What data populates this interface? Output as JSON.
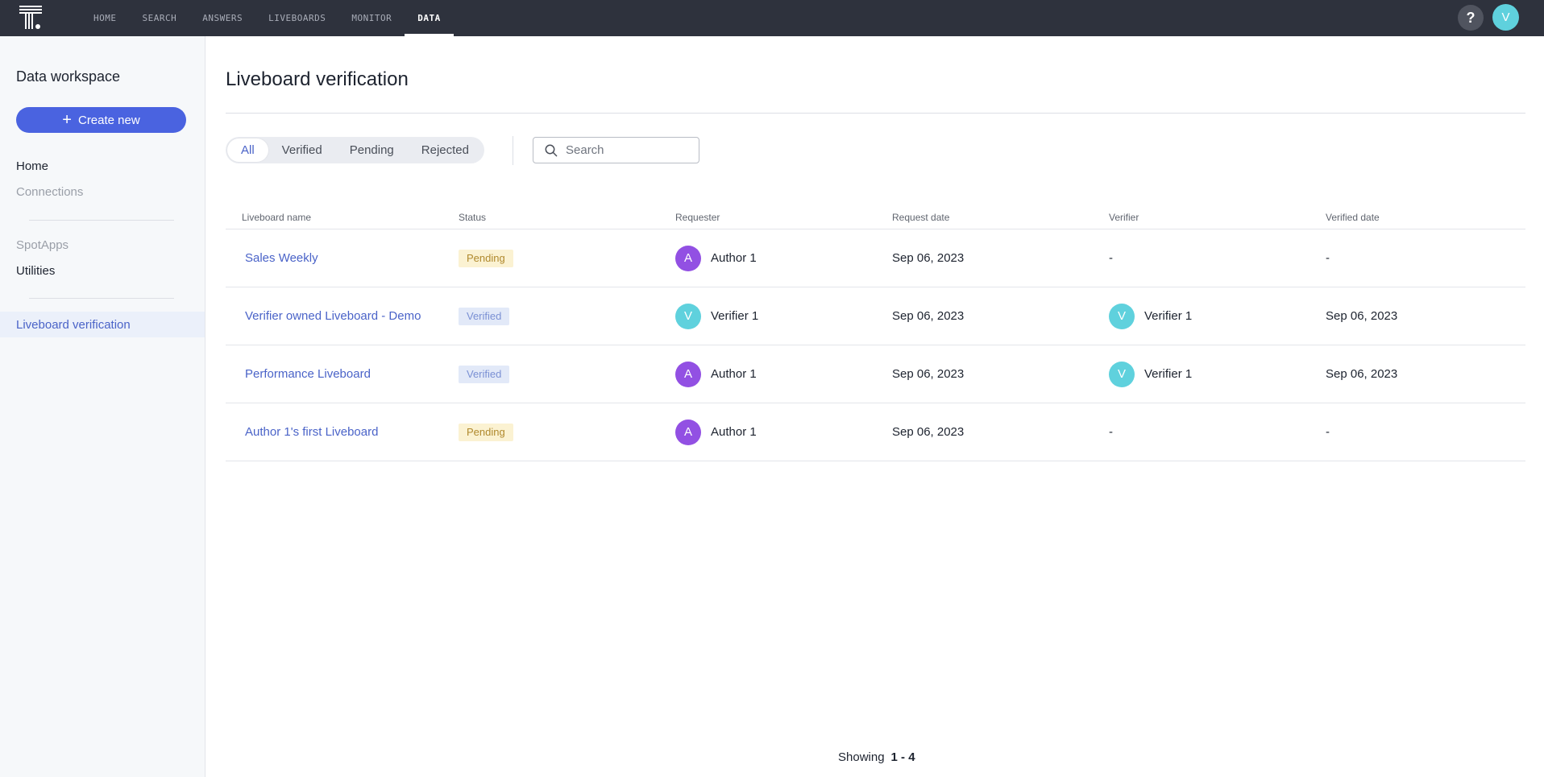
{
  "topnav": {
    "items": [
      {
        "label": "HOME",
        "active": false
      },
      {
        "label": "SEARCH",
        "active": false
      },
      {
        "label": "ANSWERS",
        "active": false
      },
      {
        "label": "LIVEBOARDS",
        "active": false
      },
      {
        "label": "MONITOR",
        "active": false
      },
      {
        "label": "DATA",
        "active": true
      }
    ],
    "help_label": "?",
    "user_initial": "V"
  },
  "sidebar": {
    "title": "Data workspace",
    "create_label": "Create new",
    "items": [
      {
        "label": "Home",
        "muted": false
      },
      {
        "label": "Connections",
        "muted": true
      },
      {
        "label": "SpotApps",
        "muted": true
      },
      {
        "label": "Utilities",
        "muted": false
      }
    ],
    "active_item": "Liveboard verification"
  },
  "main": {
    "title": "Liveboard verification",
    "filters": [
      "All",
      "Verified",
      "Pending",
      "Rejected"
    ],
    "active_filter": "All",
    "search_placeholder": "Search",
    "search_value": "",
    "columns": [
      "Liveboard name",
      "Status",
      "Requester",
      "Request date",
      "Verifier",
      "Verified date"
    ],
    "rows": [
      {
        "name": "Sales Weekly",
        "status": "Pending",
        "requester": {
          "initial": "A",
          "name": "Author 1"
        },
        "request_date": "Sep 06, 2023",
        "verifier": null,
        "verifier_placeholder": "-",
        "verified_date": "-"
      },
      {
        "name": "Verifier owned Liveboard - Demo",
        "status": "Verified",
        "requester": {
          "initial": "V",
          "name": "Verifier 1"
        },
        "request_date": "Sep 06, 2023",
        "verifier": {
          "initial": "V",
          "name": "Verifier 1"
        },
        "verifier_placeholder": "-",
        "verified_date": "Sep 06, 2023"
      },
      {
        "name": "Performance Liveboard",
        "status": "Verified",
        "requester": {
          "initial": "A",
          "name": "Author 1"
        },
        "request_date": "Sep 06, 2023",
        "verifier": {
          "initial": "V",
          "name": "Verifier 1"
        },
        "verifier_placeholder": "-",
        "verified_date": "Sep 06, 2023"
      },
      {
        "name": "Author 1's first Liveboard",
        "status": "Pending",
        "requester": {
          "initial": "A",
          "name": "Author 1"
        },
        "request_date": "Sep 06, 2023",
        "verifier": null,
        "verifier_placeholder": "-",
        "verified_date": "-"
      }
    ],
    "footer": {
      "prefix": "Showing",
      "range": "1 - 4"
    }
  },
  "colors": {
    "nav_bg": "#2e323d",
    "accent": "#4a63e0",
    "link": "#4a63c8",
    "avatar_author": "#9250e3",
    "avatar_verifier": "#5fd1dd",
    "pending_bg": "#fbf2d2",
    "pending_text": "#b0892d",
    "verified_bg": "#e2e9f8",
    "verified_text": "#7a90d4"
  }
}
